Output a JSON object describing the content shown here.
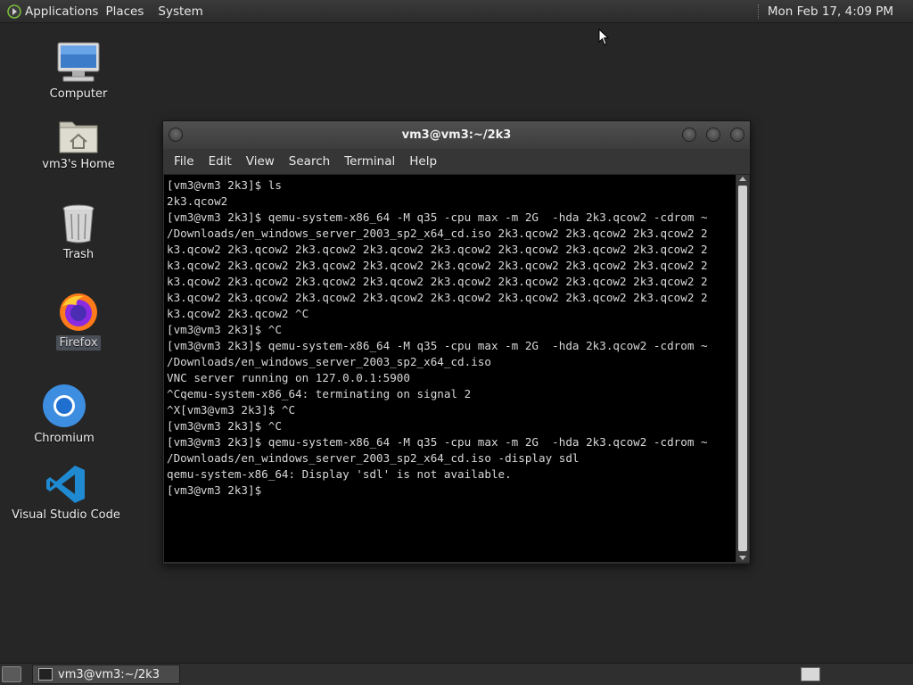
{
  "top_panel": {
    "menus": [
      "Applications",
      "Places",
      "System"
    ],
    "clock": "Mon Feb 17,  4:09 PM"
  },
  "desktop": {
    "icons": [
      {
        "label": "Computer",
        "icon": "computer-icon"
      },
      {
        "label": "vm3's Home",
        "icon": "home-folder-icon"
      },
      {
        "label": "Trash",
        "icon": "trash-icon"
      },
      {
        "label": "Firefox",
        "icon": "firefox-icon"
      },
      {
        "label": "Chromium",
        "icon": "chromium-icon"
      },
      {
        "label": "Visual Studio Code",
        "icon": "vscode-icon"
      }
    ]
  },
  "terminal": {
    "title": "vm3@vm3:~/2k3",
    "menu": [
      "File",
      "Edit",
      "View",
      "Search",
      "Terminal",
      "Help"
    ],
    "lines": [
      "[vm3@vm3 2k3]$ ls",
      "2k3.qcow2",
      "[vm3@vm3 2k3]$ qemu-system-x86_64 -M q35 -cpu max -m 2G  -hda 2k3.qcow2 -cdrom ~",
      "/Downloads/en_windows_server_2003_sp2_x64_cd.iso 2k3.qcow2 2k3.qcow2 2k3.qcow2 2",
      "k3.qcow2 2k3.qcow2 2k3.qcow2 2k3.qcow2 2k3.qcow2 2k3.qcow2 2k3.qcow2 2k3.qcow2 2",
      "k3.qcow2 2k3.qcow2 2k3.qcow2 2k3.qcow2 2k3.qcow2 2k3.qcow2 2k3.qcow2 2k3.qcow2 2",
      "k3.qcow2 2k3.qcow2 2k3.qcow2 2k3.qcow2 2k3.qcow2 2k3.qcow2 2k3.qcow2 2k3.qcow2 2",
      "k3.qcow2 2k3.qcow2 2k3.qcow2 2k3.qcow2 2k3.qcow2 2k3.qcow2 2k3.qcow2 2k3.qcow2 2",
      "k3.qcow2 2k3.qcow2 ^C",
      "[vm3@vm3 2k3]$ ^C",
      "[vm3@vm3 2k3]$ qemu-system-x86_64 -M q35 -cpu max -m 2G  -hda 2k3.qcow2 -cdrom ~",
      "/Downloads/en_windows_server_2003_sp2_x64_cd.iso",
      "VNC server running on 127.0.0.1:5900",
      "^Cqemu-system-x86_64: terminating on signal 2",
      "^X[vm3@vm3 2k3]$ ^C",
      "[vm3@vm3 2k3]$ ^C",
      "[vm3@vm3 2k3]$ qemu-system-x86_64 -M q35 -cpu max -m 2G  -hda 2k3.qcow2 -cdrom ~",
      "/Downloads/en_windows_server_2003_sp2_x64_cd.iso -display sdl",
      "qemu-system-x86_64: Display 'sdl' is not available.",
      "[vm3@vm3 2k3]$ "
    ]
  },
  "taskbar": {
    "task_label": "vm3@vm3:~/2k3"
  }
}
